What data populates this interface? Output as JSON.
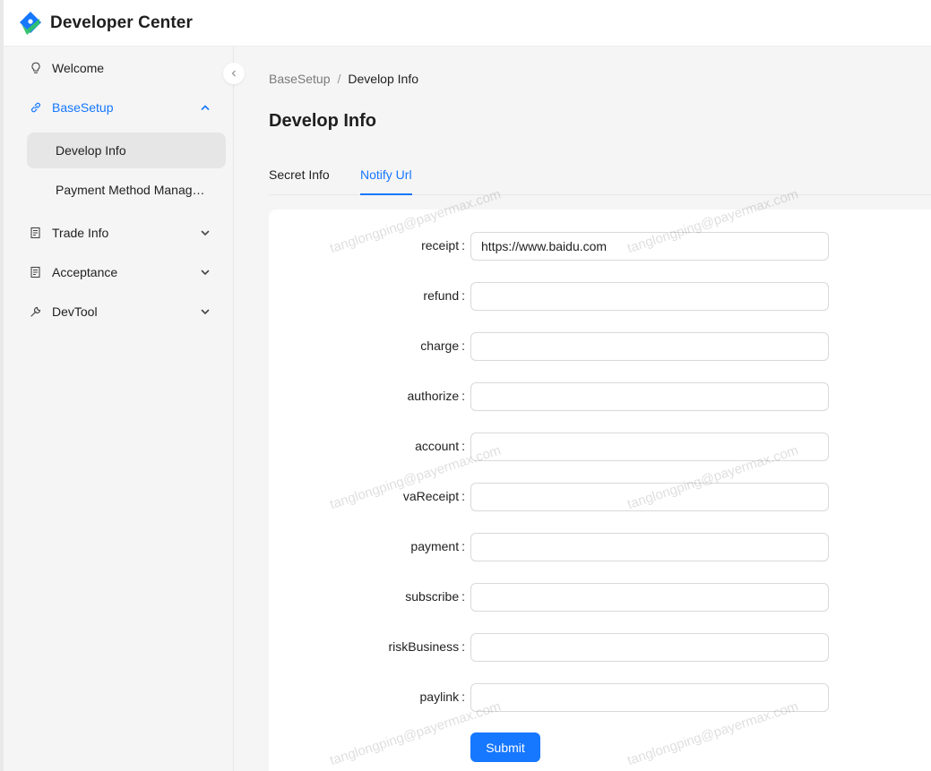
{
  "app": {
    "title": "Developer Center"
  },
  "sidebar": {
    "items": [
      {
        "label": "Welcome",
        "icon": "bulb-icon"
      },
      {
        "label": "BaseSetup",
        "icon": "link-icon",
        "expanded": true
      },
      {
        "label": "Develop Info",
        "selected": true
      },
      {
        "label": "Payment Method Management"
      },
      {
        "label": "Trade Info",
        "icon": "document-icon"
      },
      {
        "label": "Acceptance",
        "icon": "document-icon"
      },
      {
        "label": "DevTool",
        "icon": "wrench-icon"
      }
    ]
  },
  "breadcrumb": {
    "parent": "BaseSetup",
    "separator": "/",
    "current": "Develop Info"
  },
  "page": {
    "title": "Develop Info"
  },
  "tabs": [
    {
      "label": "Secret Info",
      "active": false
    },
    {
      "label": "Notify Url",
      "active": true
    }
  ],
  "form": {
    "fields": [
      {
        "label": "receipt",
        "value": "https://www.baidu.com"
      },
      {
        "label": "refund",
        "value": ""
      },
      {
        "label": "charge",
        "value": ""
      },
      {
        "label": "authorize",
        "value": ""
      },
      {
        "label": "account",
        "value": ""
      },
      {
        "label": "vaReceipt",
        "value": ""
      },
      {
        "label": "payment",
        "value": ""
      },
      {
        "label": "subscribe",
        "value": ""
      },
      {
        "label": "riskBusiness",
        "value": ""
      },
      {
        "label": "paylink",
        "value": ""
      }
    ],
    "colon": ":",
    "submit_label": "Submit"
  },
  "watermark": {
    "text": "tanglongping@payermax.com"
  },
  "colors": {
    "accent": "#1677ff",
    "selected_bg": "#e6e6e6"
  }
}
